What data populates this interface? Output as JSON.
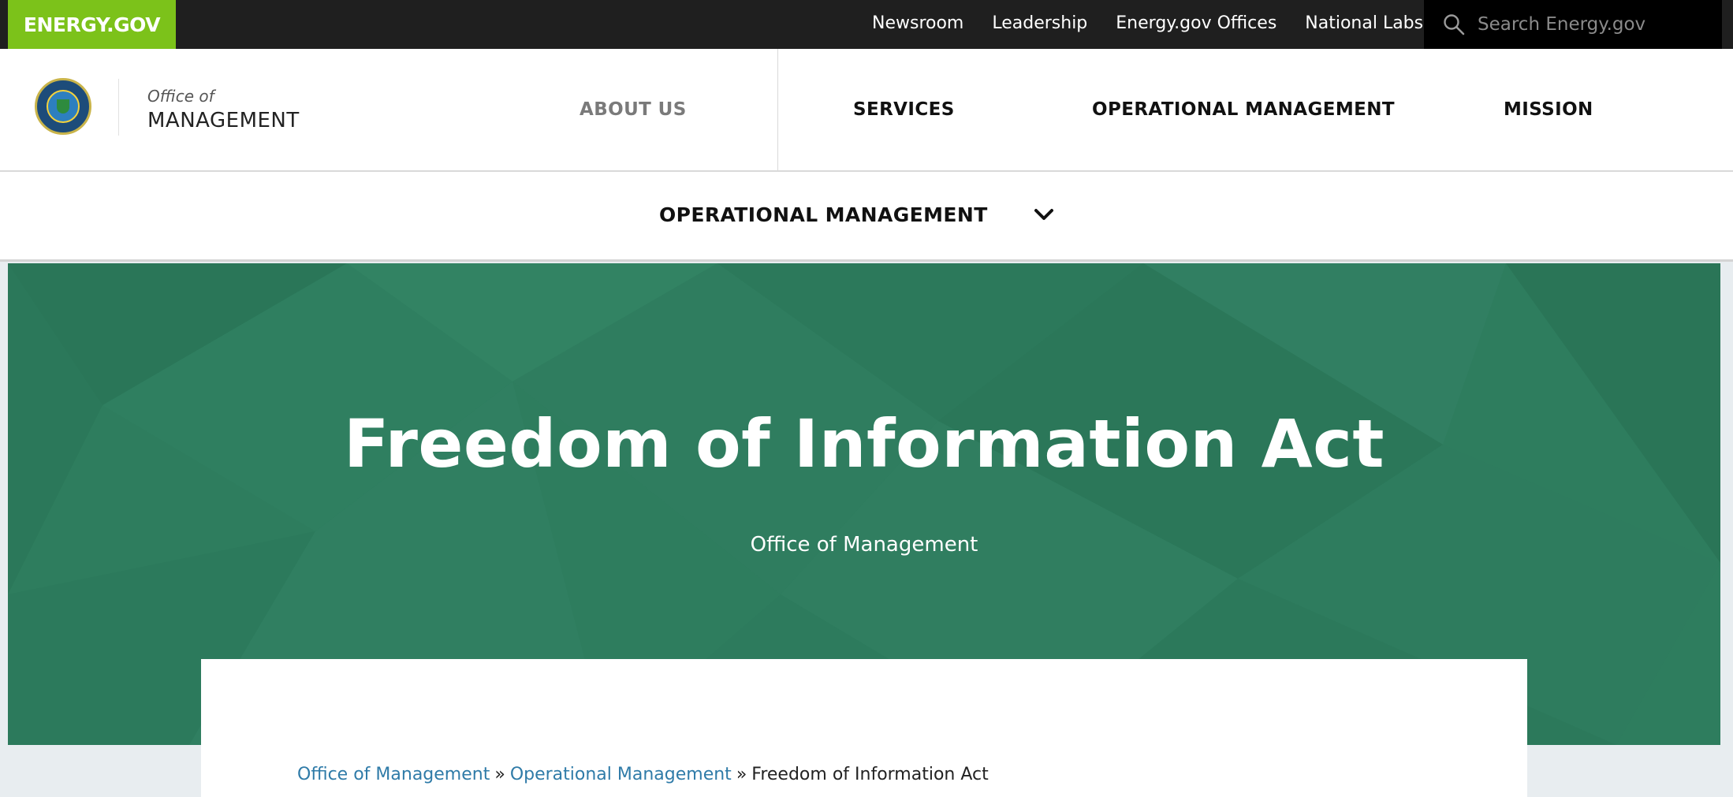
{
  "topbar": {
    "brand": "ENERGY.GOV",
    "links": [
      "Newsroom",
      "Leadership",
      "Energy.gov Offices",
      "National Labs"
    ],
    "search_placeholder": "Search Energy.gov"
  },
  "header": {
    "office_of": "Office of",
    "office_name": "MANAGEMENT",
    "nav": [
      "ABOUT US",
      "SERVICES",
      "OPERATIONAL MANAGEMENT",
      "MISSION"
    ]
  },
  "section": {
    "label": "OPERATIONAL MANAGEMENT"
  },
  "hero": {
    "title": "Freedom of Information Act",
    "subtitle": "Office of Management"
  },
  "breadcrumb": {
    "items": [
      "Office of Management",
      "Operational Management"
    ],
    "separator": "»",
    "current": "Freedom of Information Act"
  },
  "colors": {
    "brand_green": "#7cc21a",
    "hero_green": "#2e7d5e",
    "link_blue": "#2f7ba8",
    "topbar_dark": "#1f1f1f"
  }
}
